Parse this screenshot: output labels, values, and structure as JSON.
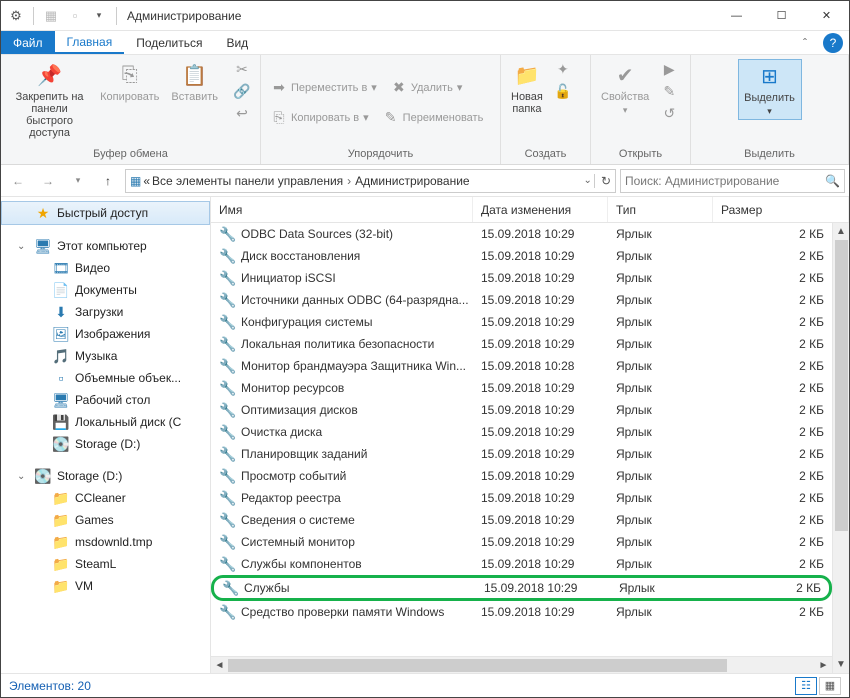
{
  "window": {
    "title": "Администрирование"
  },
  "menu": {
    "file": "Файл",
    "tabs": [
      "Главная",
      "Поделиться",
      "Вид"
    ]
  },
  "ribbon": {
    "clipboard": {
      "label": "Буфер обмена",
      "pin": "Закрепить на панели\nбыстрого доступа",
      "copy": "Копировать",
      "paste": "Вставить"
    },
    "organize": {
      "label": "Упорядочить",
      "move": "Переместить в",
      "copyto": "Копировать в",
      "delete": "Удалить",
      "rename": "Переименовать"
    },
    "new": {
      "label": "Создать",
      "newfolder": "Новая\nпапка"
    },
    "open": {
      "label": "Открыть",
      "properties": "Свойства"
    },
    "select": {
      "label": "Выделить",
      "select": "Выделить"
    }
  },
  "address": {
    "prefix": "«",
    "crumb1": "Все элементы панели управления",
    "crumb2": "Администрирование"
  },
  "search": {
    "placeholder": "Поиск: Администрирование"
  },
  "nav": {
    "quick": "Быстрый доступ",
    "thispc": "Этот компьютер",
    "children": [
      "Видео",
      "Документы",
      "Загрузки",
      "Изображения",
      "Музыка",
      "Объемные объек...",
      "Рабочий стол",
      "Локальный диск (C",
      "Storage (D:)"
    ],
    "storage": "Storage (D:)",
    "storagech": [
      "CCleaner",
      "Games",
      "msdownld.tmp",
      "SteamL",
      "VM"
    ]
  },
  "columns": {
    "name": "Имя",
    "date": "Дата изменения",
    "type": "Тип",
    "size": "Размер"
  },
  "rows": [
    {
      "n": "ODBC Data Sources (32-bit)",
      "d": "15.09.2018 10:29",
      "t": "Ярлык",
      "s": "2 КБ"
    },
    {
      "n": "Диск восстановления",
      "d": "15.09.2018 10:29",
      "t": "Ярлык",
      "s": "2 КБ"
    },
    {
      "n": "Инициатор iSCSI",
      "d": "15.09.2018 10:29",
      "t": "Ярлык",
      "s": "2 КБ"
    },
    {
      "n": "Источники данных ODBC (64-разрядна...",
      "d": "15.09.2018 10:29",
      "t": "Ярлык",
      "s": "2 КБ"
    },
    {
      "n": "Конфигурация системы",
      "d": "15.09.2018 10:29",
      "t": "Ярлык",
      "s": "2 КБ"
    },
    {
      "n": "Локальная политика безопасности",
      "d": "15.09.2018 10:29",
      "t": "Ярлык",
      "s": "2 КБ"
    },
    {
      "n": "Монитор брандмауэра Защитника Win...",
      "d": "15.09.2018 10:28",
      "t": "Ярлык",
      "s": "2 КБ"
    },
    {
      "n": "Монитор ресурсов",
      "d": "15.09.2018 10:29",
      "t": "Ярлык",
      "s": "2 КБ"
    },
    {
      "n": "Оптимизация дисков",
      "d": "15.09.2018 10:29",
      "t": "Ярлык",
      "s": "2 КБ"
    },
    {
      "n": "Очистка диска",
      "d": "15.09.2018 10:29",
      "t": "Ярлык",
      "s": "2 КБ"
    },
    {
      "n": "Планировщик заданий",
      "d": "15.09.2018 10:29",
      "t": "Ярлык",
      "s": "2 КБ"
    },
    {
      "n": "Просмотр событий",
      "d": "15.09.2018 10:29",
      "t": "Ярлык",
      "s": "2 КБ"
    },
    {
      "n": "Редактор реестра",
      "d": "15.09.2018 10:29",
      "t": "Ярлык",
      "s": "2 КБ"
    },
    {
      "n": "Сведения о системе",
      "d": "15.09.2018 10:29",
      "t": "Ярлык",
      "s": "2 КБ"
    },
    {
      "n": "Системный монитор",
      "d": "15.09.2018 10:29",
      "t": "Ярлык",
      "s": "2 КБ"
    },
    {
      "n": "Службы компонентов",
      "d": "15.09.2018 10:29",
      "t": "Ярлык",
      "s": "2 КБ"
    },
    {
      "n": "Службы",
      "d": "15.09.2018 10:29",
      "t": "Ярлык",
      "s": "2 КБ",
      "hl": true
    },
    {
      "n": "Средство проверки памяти Windows",
      "d": "15.09.2018 10:29",
      "t": "Ярлык",
      "s": "2 КБ"
    }
  ],
  "status": {
    "count": "Элементов: 20"
  },
  "icons": {
    "navch": [
      "🎞",
      "📄",
      "⬇",
      "🖼",
      "🎵",
      "▫",
      "🖥",
      "💾",
      "💽"
    ]
  }
}
